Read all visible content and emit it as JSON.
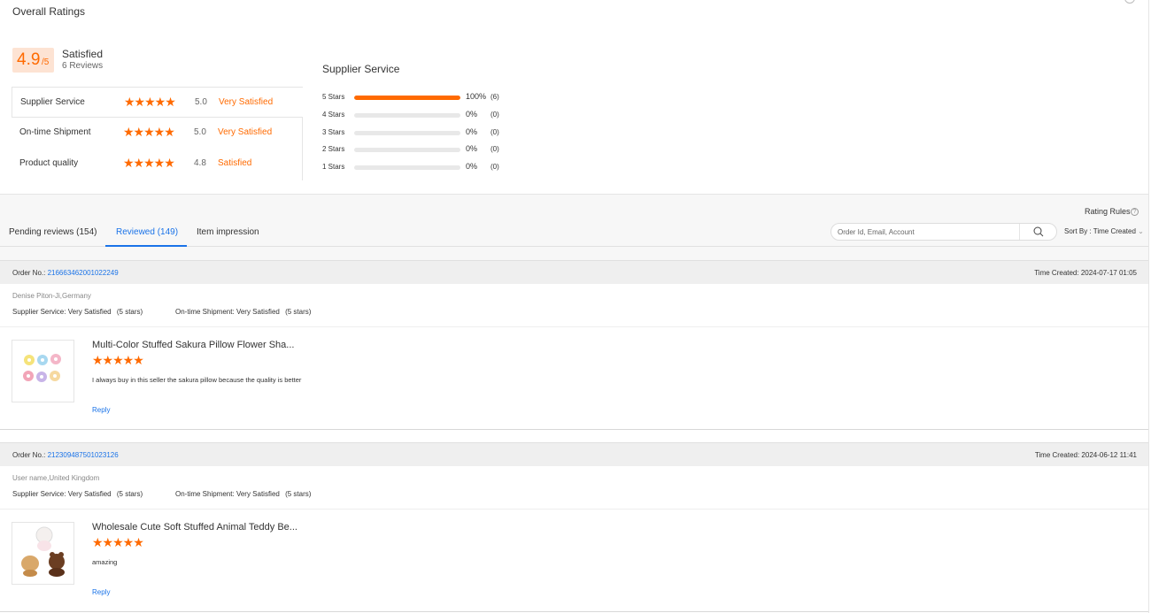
{
  "overall": {
    "title": "Overall Ratings",
    "score": "4.9",
    "score_suffix": "/5",
    "score_label": "Satisfied",
    "review_count": "6 Reviews",
    "categories": [
      {
        "name": "Supplier Service",
        "stars": "★★★★★",
        "score": "5.0",
        "status": "Very Satisfied"
      },
      {
        "name": "On-time Shipment",
        "stars": "★★★★★",
        "score": "5.0",
        "status": "Very Satisfied"
      },
      {
        "name": "Product quality",
        "stars": "★★★★★",
        "score": "4.8",
        "status": "Satisfied"
      }
    ]
  },
  "distribution": {
    "title": "Supplier Service",
    "rows": [
      {
        "label": "5 Stars",
        "fraction": 1.0,
        "percent": "100%",
        "count": "(6)"
      },
      {
        "label": "4 Stars",
        "fraction": 0.0,
        "percent": "0%",
        "count": "(0)"
      },
      {
        "label": "3 Stars",
        "fraction": 0.0,
        "percent": "0%",
        "count": "(0)"
      },
      {
        "label": "2 Stars",
        "fraction": 0.0,
        "percent": "0%",
        "count": "(0)"
      },
      {
        "label": "1 Stars",
        "fraction": 0.0,
        "percent": "0%",
        "count": "(0)"
      }
    ]
  },
  "toolbar": {
    "rating_rules": "Rating Rules",
    "rules_help": "?",
    "tabs": [
      {
        "label": "Pending reviews (154)"
      },
      {
        "label": "Reviewed (149)"
      },
      {
        "label": "Item impression"
      }
    ],
    "search_placeholder": "Order Id, Email, Account",
    "sort_label": "Sort By : Time Created"
  },
  "colors": {
    "accent": "#ff6a00",
    "link": "#1a73e8"
  },
  "orders": [
    {
      "order_label": "Order No.:",
      "order_no": "216663462001022249",
      "time_created": "Time Created: 2024-07-17 01:05",
      "buyer": "Denise Piton-Ji,Germany",
      "supplier_service_label": "Supplier Service:",
      "supplier_service_value": "Very Satisfied",
      "supplier_service_stars": "(5 stars)",
      "shipment_label": "On-time Shipment:",
      "shipment_value": "Very Satisfied",
      "shipment_stars": "(5 stars)",
      "product_title": "Multi-Color Stuffed Sakura Pillow Flower Sha...",
      "product_stars": "★★★★★",
      "comment": "I always buy in this seller the sakura pillow because the quality is better",
      "reply": "Reply",
      "thumb_icon": "flower-pillows-icon"
    },
    {
      "order_label": "Order No.:",
      "order_no": "212309487501023126",
      "time_created": "Time Created: 2024-06-12 11:41",
      "buyer": "User name,United Kingdom",
      "supplier_service_label": "Supplier Service:",
      "supplier_service_value": "Very Satisfied",
      "supplier_service_stars": "(5 stars)",
      "shipment_label": "On-time Shipment:",
      "shipment_value": "Very Satisfied",
      "shipment_stars": "(5 stars)",
      "product_title": "Wholesale Cute Soft Stuffed Animal Teddy Be...",
      "product_stars": "★★★★★",
      "comment": "amazing",
      "reply": "Reply",
      "thumb_icon": "stuffed-animals-icon"
    }
  ]
}
